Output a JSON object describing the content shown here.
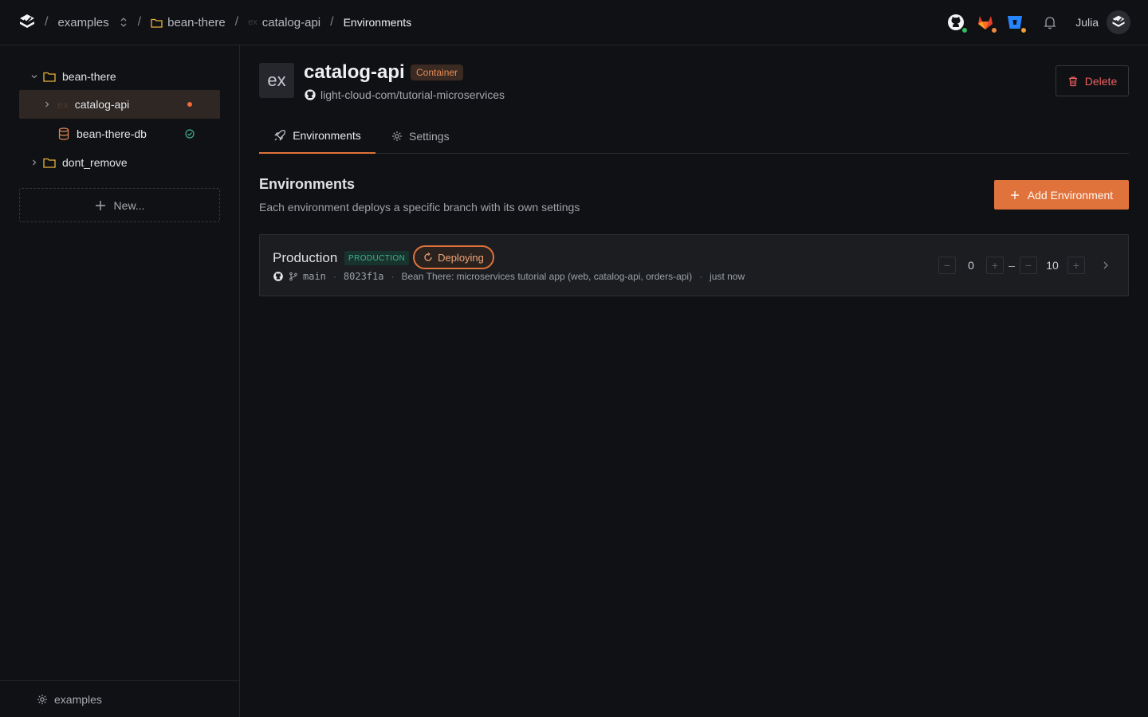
{
  "breadcrumbs": {
    "workspace": "examples",
    "project": "bean-there",
    "service": "catalog-api",
    "page": "Environments"
  },
  "user": {
    "name": "Julia"
  },
  "icons": {
    "github": "github-icon",
    "gitlab": "gitlab-icon",
    "bitbucket": "bitbucket-icon",
    "bell": "bell-icon"
  },
  "colors": {
    "accent": "#e0733c",
    "github_status": "#2fbf5b",
    "gitlab_status": "#f08a3a",
    "bitbucket_status": "#f0a03a",
    "danger": "#ea5f5f",
    "success": "#3fb08f"
  },
  "sidebar": {
    "tree": [
      {
        "label": "bean-there",
        "kind": "folder",
        "expanded": true
      },
      {
        "label": "catalog-api",
        "kind": "service",
        "prefix": "ex",
        "status": "deploying"
      },
      {
        "label": "bean-there-db",
        "kind": "database",
        "status": "healthy"
      },
      {
        "label": "dont_remove",
        "kind": "folder",
        "expanded": false
      }
    ],
    "new_label": "New...",
    "footer_label": "examples"
  },
  "service": {
    "badge": "ex",
    "name": "catalog-api",
    "type": "Container",
    "repo": "light-cloud-com/tutorial-microservices",
    "delete_label": "Delete"
  },
  "tabs": [
    {
      "label": "Environments",
      "active": true
    },
    {
      "label": "Settings",
      "active": false
    }
  ],
  "environments_section": {
    "title": "Environments",
    "subtitle": "Each environment deploys a specific branch with its own settings",
    "add_label": "Add Environment"
  },
  "environments": [
    {
      "name": "Production",
      "tag": "PRODUCTION",
      "status": "Deploying",
      "branch": "main",
      "commit": "8023f1a",
      "message": "Bean There: microservices tutorial app (web, catalog-api, orders-api)",
      "time": "just now",
      "min_instances": "0",
      "max_instances": "10",
      "range_separator": "–"
    }
  ]
}
